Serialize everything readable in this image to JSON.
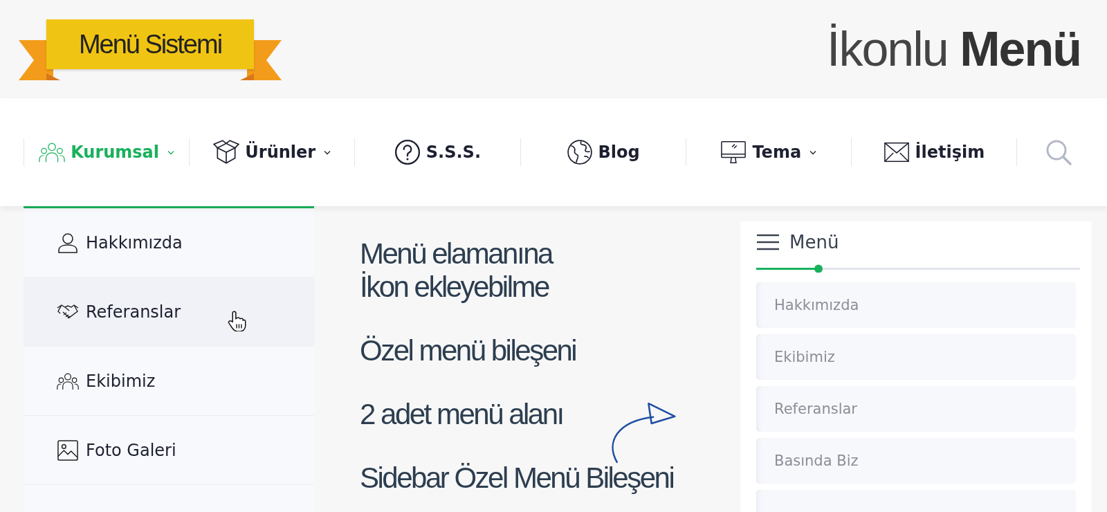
{
  "header": {
    "ribbon": "Menü Sistemi",
    "title_light": "İkonlu",
    "title_bold": "Menü"
  },
  "nav": [
    {
      "label": "Kurumsal",
      "selected": true,
      "dropdown": true
    },
    {
      "label": "Ürünler",
      "selected": false,
      "dropdown": true
    },
    {
      "label": "S.S.S.",
      "selected": false,
      "dropdown": false
    },
    {
      "label": "Blog",
      "selected": false,
      "dropdown": false
    },
    {
      "label": "Tema",
      "selected": false,
      "dropdown": true
    },
    {
      "label": "İletişim",
      "selected": false,
      "dropdown": false
    }
  ],
  "dropdown": [
    {
      "label": "Hakkımızda",
      "hovered": false
    },
    {
      "label": "Referanslar",
      "hovered": true
    },
    {
      "label": "Ekibimiz",
      "hovered": false
    },
    {
      "label": "Foto Galeri",
      "hovered": false
    }
  ],
  "features": [
    "Menü elamanına\nİkon ekleyebilme",
    "Özel menü bileşeni",
    "2 adet menü alanı",
    "Sidebar Özel Menü Bileşeni"
  ],
  "sidebar": {
    "title": "Menü",
    "items": [
      "Hakkımızda",
      "Ekibimiz",
      "Referanslar",
      "Basında Biz"
    ]
  }
}
